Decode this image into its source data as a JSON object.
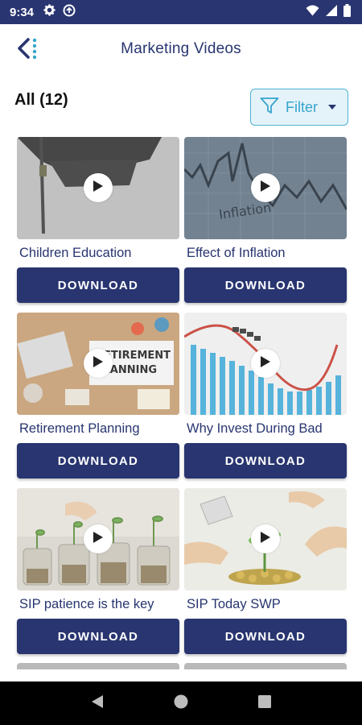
{
  "status_bar": {
    "time": "9:34",
    "left_icons": [
      "gear-icon",
      "data-saver-icon"
    ],
    "right_icons": [
      "wifi-icon",
      "signal-icon",
      "battery-icon"
    ]
  },
  "header": {
    "title": "Marketing Videos",
    "back_icon": "back-arrow-icon"
  },
  "toolbar": {
    "count_label": "All (12)",
    "filter_label": "Filter",
    "filter_icon": "funnel-icon"
  },
  "videos": [
    {
      "title": "Children Education",
      "button": "DOWNLOAD"
    },
    {
      "title": "Effect of Inflation",
      "button": "DOWNLOAD"
    },
    {
      "title": "Retirement Planning",
      "button": "DOWNLOAD"
    },
    {
      "title": "Why Invest During Bad",
      "button": "DOWNLOAD"
    },
    {
      "title": "SIP patience is the key",
      "button": "DOWNLOAD"
    },
    {
      "title": "SIP Today SWP",
      "button": "DOWNLOAD"
    }
  ],
  "thumbnail_text": {
    "inflation": "Inflation",
    "retirement_line1": "RETIREMENT",
    "retirement_line2": "PLANNING"
  },
  "nav_bar": [
    "back-triangle-icon",
    "home-circle-icon",
    "recents-square-icon"
  ],
  "colors": {
    "primary": "#283570",
    "accent": "#36a4cc",
    "filter_bg": "#e4f3f9"
  }
}
